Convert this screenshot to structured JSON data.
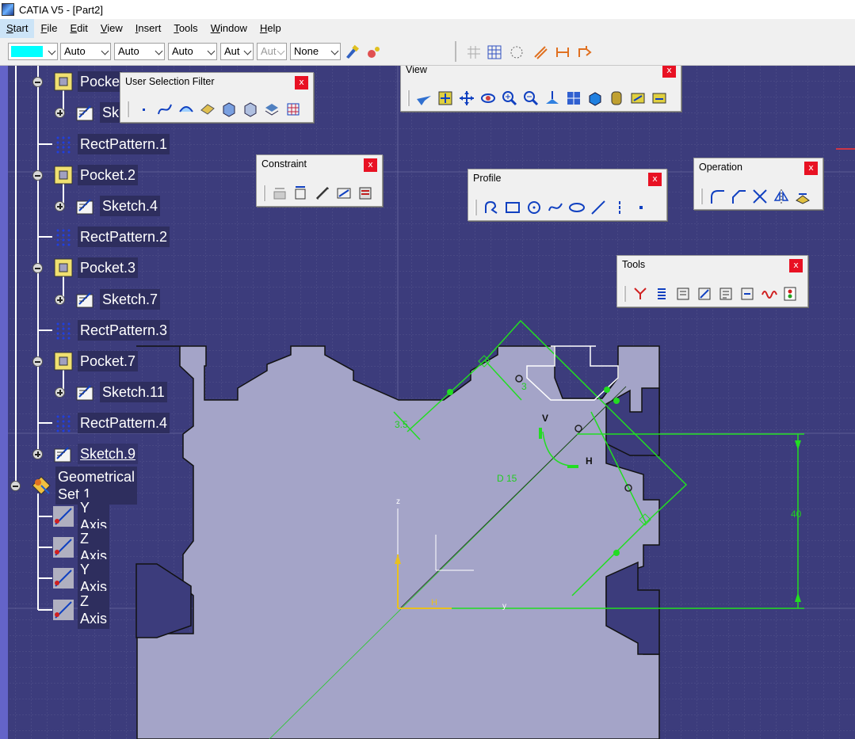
{
  "window": {
    "title": "CATIA V5 - [Part2]"
  },
  "menu": [
    {
      "label": "Start",
      "hot": "S",
      "rest": "tart"
    },
    {
      "label": "File",
      "hot": "F",
      "rest": "ile"
    },
    {
      "label": "Edit",
      "hot": "E",
      "rest": "dit"
    },
    {
      "label": "View",
      "hot": "V",
      "rest": "iew"
    },
    {
      "label": "Insert",
      "hot": "I",
      "rest": "nsert"
    },
    {
      "label": "Tools",
      "hot": "T",
      "rest": "ools"
    },
    {
      "label": "Window",
      "hot": "W",
      "rest": "indow"
    },
    {
      "label": "Help",
      "hot": "H",
      "rest": "elp"
    }
  ],
  "toolbar": {
    "color_swatch": "#00ffff",
    "combos": [
      "Auto",
      "Auto",
      "Auto",
      "Aut",
      "Aut",
      "None"
    ]
  },
  "tree": [
    {
      "label": "Pocke",
      "icon": "pocket-icon",
      "expander": "minus"
    },
    {
      "label": "Sk",
      "icon": "sketch-icon",
      "expander": "plus"
    },
    {
      "label": "RectPattern.1",
      "icon": "rect-pattern-icon",
      "expander": "none"
    },
    {
      "label": "Pocket.2",
      "icon": "pocket-icon",
      "expander": "minus"
    },
    {
      "label": "Sketch.4",
      "icon": "sketch-icon",
      "expander": "plus"
    },
    {
      "label": "RectPattern.2",
      "icon": "rect-pattern-icon",
      "expander": "none"
    },
    {
      "label": "Pocket.3",
      "icon": "pocket-icon",
      "expander": "minus"
    },
    {
      "label": "Sketch.7",
      "icon": "sketch-icon",
      "expander": "plus"
    },
    {
      "label": "RectPattern.3",
      "icon": "rect-pattern-icon",
      "expander": "none"
    },
    {
      "label": "Pocket.7",
      "icon": "pocket-icon",
      "expander": "minus"
    },
    {
      "label": "Sketch.11",
      "icon": "sketch-icon",
      "expander": "plus"
    },
    {
      "label": "RectPattern.4",
      "icon": "rect-pattern-icon",
      "expander": "none"
    },
    {
      "label": "Sketch.9",
      "icon": "sketch-icon",
      "expander": "plus"
    },
    {
      "label": "Geometrical Set.1",
      "icon": "geometrical-set-icon",
      "expander": "minus"
    },
    {
      "label": "Y Axis",
      "icon": "axis-icon",
      "expander": "none"
    },
    {
      "label": "Z Axis",
      "icon": "axis-icon",
      "expander": "none"
    },
    {
      "label": "Y Axis",
      "icon": "axis-icon",
      "expander": "none"
    },
    {
      "label": "Z Axis",
      "icon": "axis-icon",
      "expander": "none"
    }
  ],
  "panels": {
    "user_selection_filter": {
      "title": "User Selection Filter",
      "close": "x"
    },
    "view": {
      "title": "View",
      "close": "x"
    },
    "constraint": {
      "title": "Constraint",
      "close": "x"
    },
    "profile": {
      "title": "Profile",
      "close": "x"
    },
    "operation": {
      "title": "Operation",
      "close": "x"
    },
    "tools": {
      "title": "Tools",
      "close": "x"
    }
  },
  "sketch": {
    "dim_35": "3.5",
    "dim_3": "3",
    "dim_d15": "D 15",
    "dim_40": "40",
    "label_v": "V",
    "label_h": "H",
    "label_hh": "H",
    "axis_z": "z",
    "axis_y": "y"
  },
  "colors": {
    "viewport_bg": "#3c3c7c",
    "part_fill": "#a4a4c8",
    "sketch_green": "#22dd22",
    "axis_yellow": "#e8c020"
  }
}
